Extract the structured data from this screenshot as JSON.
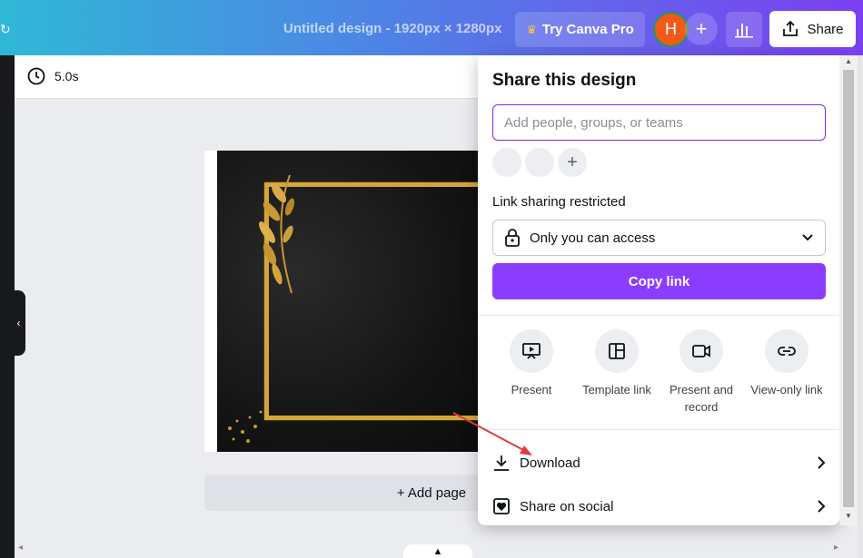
{
  "topbar": {
    "title": "Untitled design - 1920px × 1280px",
    "pro_label": "Try Canva Pro",
    "avatar_initial": "H",
    "share_label": "Share"
  },
  "editor": {
    "duration": "5.0s",
    "add_page_label": "+ Add page"
  },
  "share_panel": {
    "title": "Share this design",
    "people_placeholder": "Add people, groups, or teams",
    "link_sharing_label": "Link sharing restricted",
    "access_value": "Only you can access",
    "copy_link_label": "Copy link",
    "options": [
      {
        "label": "Present",
        "icon": "present-icon"
      },
      {
        "label": "Template link",
        "icon": "template-icon"
      },
      {
        "label": "Present and record",
        "icon": "record-icon"
      },
      {
        "label": "View-only link",
        "icon": "link-icon"
      }
    ],
    "rows": [
      {
        "label": "Download",
        "icon": "download-icon"
      },
      {
        "label": "Share on social",
        "icon": "heart-icon"
      }
    ]
  },
  "colors": {
    "accent": "#8b3dff",
    "input_border": "#7d2ae8",
    "gold": "#d4a63a",
    "annotation_arrow": "#e03c3c"
  }
}
